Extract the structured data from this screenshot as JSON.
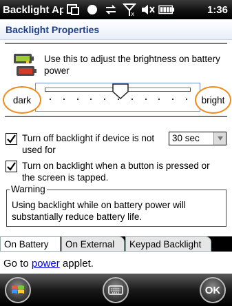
{
  "titlebar": {
    "app_title": "Backlight Applet",
    "time": "1:36",
    "icons": [
      "windows-icon",
      "bullet-icon",
      "sync-icon",
      "no-signal-icon",
      "volume-mute-icon",
      "battery-icon"
    ]
  },
  "header": {
    "title": "Backlight Properties"
  },
  "intro_text": "Use this to adjust the brightness on battery power",
  "slider": {
    "min_label": "dark",
    "max_label": "bright",
    "value_fraction": 0.52,
    "tick_count": 11
  },
  "options": {
    "turn_off": {
      "checked": true,
      "label": "Turn off backlight if device is not used for"
    },
    "timeout": {
      "value": "30 sec"
    },
    "turn_on": {
      "checked": true,
      "label": "Turn on backlight when a button is pressed or the screen is tapped."
    }
  },
  "warning": {
    "legend": "Warning",
    "text": "Using backlight while on battery power will substantially reduce battery life."
  },
  "tabs": [
    {
      "label": "On Battery",
      "active": true
    },
    {
      "label": "On External",
      "active": false
    },
    {
      "label": "Keypad Backlight",
      "active": false
    }
  ],
  "footer": {
    "prefix": "Go to ",
    "link": "power",
    "suffix": " applet."
  },
  "softkeys": {
    "ok": "OK"
  },
  "colors": {
    "highlight_ring": "#f08a1c",
    "header_text": "#1f3f8a",
    "link": "#0000ee"
  }
}
